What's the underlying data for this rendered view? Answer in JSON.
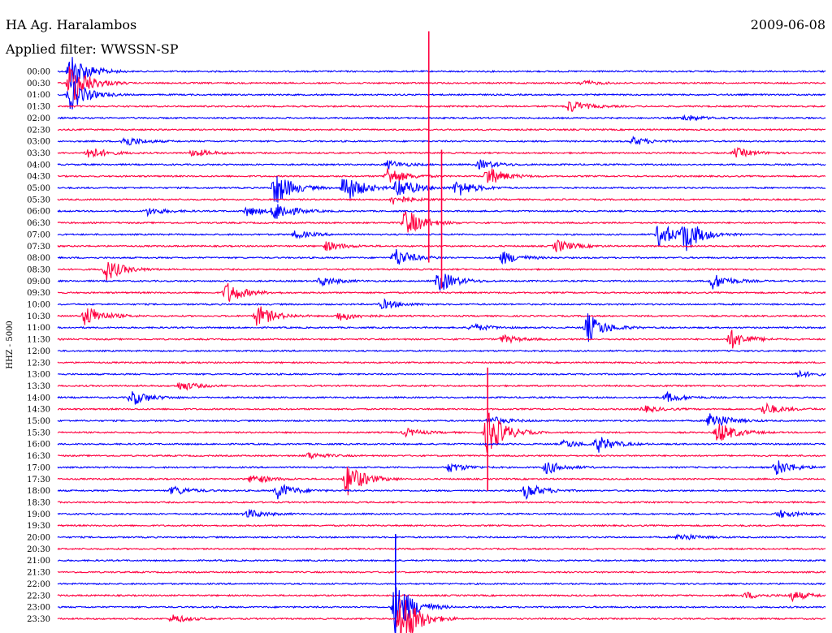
{
  "header": {
    "station": "HA Ag. Haralambos",
    "date": "2009-06-08",
    "filter_label": "Applied filter: WWSSN-SP"
  },
  "chart_data": {
    "type": "line",
    "title": "HA Ag. Haralambos",
    "ylabel": "HHZ - 5000",
    "row_labels": [
      "00:00",
      "00:30",
      "01:00",
      "01:30",
      "02:00",
      "02:30",
      "03:00",
      "03:30",
      "04:00",
      "04:30",
      "05:00",
      "05:30",
      "06:00",
      "06:30",
      "07:00",
      "07:30",
      "08:00",
      "08:30",
      "09:00",
      "09:30",
      "10:00",
      "10:30",
      "11:00",
      "11:30",
      "12:00",
      "12:30",
      "13:00",
      "13:30",
      "14:00",
      "14:30",
      "15:00",
      "15:30",
      "16:00",
      "16:30",
      "17:00",
      "17:30",
      "18:00",
      "18:30",
      "19:00",
      "19:30",
      "20:00",
      "20:30",
      "21:00",
      "21:30",
      "22:00",
      "22:30",
      "23:00",
      "23:30"
    ],
    "row_minutes": 30,
    "colors": [
      "#0000ff",
      "#ff0040"
    ],
    "events": [
      {
        "row": 0,
        "minute": 0.5,
        "amp": 25
      },
      {
        "row": 1,
        "minute": 0.5,
        "amp": 30
      },
      {
        "row": 2,
        "minute": 0.5,
        "amp": 20
      },
      {
        "row": 1,
        "minute": 20.5,
        "amp": 3
      },
      {
        "row": 3,
        "minute": 20,
        "amp": 8
      },
      {
        "row": 4,
        "minute": 24.5,
        "amp": 4
      },
      {
        "row": 6,
        "minute": 2.6,
        "amp": 7
      },
      {
        "row": 6,
        "minute": 22.5,
        "amp": 5
      },
      {
        "row": 7,
        "minute": 1.2,
        "amp": 8
      },
      {
        "row": 7,
        "minute": 5.3,
        "amp": 5
      },
      {
        "row": 7,
        "minute": 26.5,
        "amp": 6
      },
      {
        "row": 8,
        "minute": 12.9,
        "amp": 5
      },
      {
        "row": 8,
        "minute": 16.5,
        "amp": 6
      },
      {
        "row": 9,
        "minute": 12.9,
        "amp": 12
      },
      {
        "row": 9,
        "minute": 16.8,
        "amp": 12
      },
      {
        "row": 10,
        "minute": 8.5,
        "amp": 22
      },
      {
        "row": 10,
        "minute": 11.2,
        "amp": 20
      },
      {
        "row": 10,
        "minute": 13.3,
        "amp": 14
      },
      {
        "row": 10,
        "minute": 15.6,
        "amp": 11
      },
      {
        "row": 11,
        "minute": 13.1,
        "amp": 6
      },
      {
        "row": 12,
        "minute": 3.5,
        "amp": 5
      },
      {
        "row": 12,
        "minute": 7.4,
        "amp": 6
      },
      {
        "row": 12,
        "minute": 8.5,
        "amp": 12
      },
      {
        "row": 13,
        "minute": 13.6,
        "amp": 18
      },
      {
        "row": 14,
        "minute": 23.5,
        "amp": 16
      },
      {
        "row": 14,
        "minute": 24.5,
        "amp": 20
      },
      {
        "row": 14,
        "minute": 9.3,
        "amp": 5
      },
      {
        "row": 15,
        "minute": 19.5,
        "amp": 8
      },
      {
        "row": 15,
        "minute": 10.5,
        "amp": 6
      },
      {
        "row": 16,
        "minute": 13.2,
        "amp": 12
      },
      {
        "row": 16,
        "minute": 17.4,
        "amp": 8
      },
      {
        "row": 17,
        "minute": 1.9,
        "amp": 14
      },
      {
        "row": 18,
        "minute": 14.9,
        "amp": 14
      },
      {
        "row": 18,
        "minute": 10.3,
        "amp": 6
      },
      {
        "row": 18,
        "minute": 25.6,
        "amp": 10
      },
      {
        "row": 19,
        "minute": 6.6,
        "amp": 14
      },
      {
        "row": 20,
        "minute": 12.7,
        "amp": 6
      },
      {
        "row": 21,
        "minute": 1.1,
        "amp": 14
      },
      {
        "row": 21,
        "minute": 7.8,
        "amp": 14
      },
      {
        "row": 21,
        "minute": 11,
        "amp": 6
      },
      {
        "row": 22,
        "minute": 20.7,
        "amp": 18
      },
      {
        "row": 22,
        "minute": 16.2,
        "amp": 5
      },
      {
        "row": 23,
        "minute": 26.3,
        "amp": 12
      },
      {
        "row": 23,
        "minute": 17.4,
        "amp": 5
      },
      {
        "row": 26,
        "minute": 28.9,
        "amp": 4
      },
      {
        "row": 27,
        "minute": 4.8,
        "amp": 6
      },
      {
        "row": 28,
        "minute": 2.9,
        "amp": 10
      },
      {
        "row": 28,
        "minute": 23.8,
        "amp": 6
      },
      {
        "row": 29,
        "minute": 27.6,
        "amp": 8
      },
      {
        "row": 29,
        "minute": 22.9,
        "amp": 4
      },
      {
        "row": 30,
        "minute": 25.5,
        "amp": 12
      },
      {
        "row": 30,
        "minute": 16.9,
        "amp": 6
      },
      {
        "row": 31,
        "minute": 16.8,
        "amp": 30
      },
      {
        "row": 31,
        "minute": 25.8,
        "amp": 14
      },
      {
        "row": 31,
        "minute": 13.6,
        "amp": 5
      },
      {
        "row": 32,
        "minute": 21.1,
        "amp": 10
      },
      {
        "row": 32,
        "minute": 19.8,
        "amp": 5
      },
      {
        "row": 33,
        "minute": 9.8,
        "amp": 4
      },
      {
        "row": 34,
        "minute": 15.3,
        "amp": 6
      },
      {
        "row": 34,
        "minute": 28.1,
        "amp": 10
      },
      {
        "row": 34,
        "minute": 19.1,
        "amp": 8
      },
      {
        "row": 35,
        "minute": 11.3,
        "amp": 22
      },
      {
        "row": 35,
        "minute": 7.6,
        "amp": 6
      },
      {
        "row": 36,
        "minute": 8.6,
        "amp": 10
      },
      {
        "row": 36,
        "minute": 18.3,
        "amp": 10
      },
      {
        "row": 36,
        "minute": 4.5,
        "amp": 6
      },
      {
        "row": 38,
        "minute": 7.4,
        "amp": 6
      },
      {
        "row": 38,
        "minute": 28.2,
        "amp": 5
      },
      {
        "row": 40,
        "minute": 24.3,
        "amp": 5
      },
      {
        "row": 45,
        "minute": 28.7,
        "amp": 6
      },
      {
        "row": 45,
        "minute": 26.9,
        "amp": 4
      },
      {
        "row": 46,
        "minute": 13.2,
        "amp": 36
      },
      {
        "row": 47,
        "minute": 13.4,
        "amp": 40
      },
      {
        "row": 47,
        "minute": 4.5,
        "amp": 5
      }
    ],
    "spikes": [
      {
        "row": 7,
        "minute": 14.5,
        "amp": 150
      },
      {
        "row": 13,
        "minute": 15.0,
        "amp": 90
      },
      {
        "row": 31,
        "minute": 16.8,
        "amp": 80
      },
      {
        "row": 46,
        "minute": 13.2,
        "amp": 90
      }
    ]
  }
}
